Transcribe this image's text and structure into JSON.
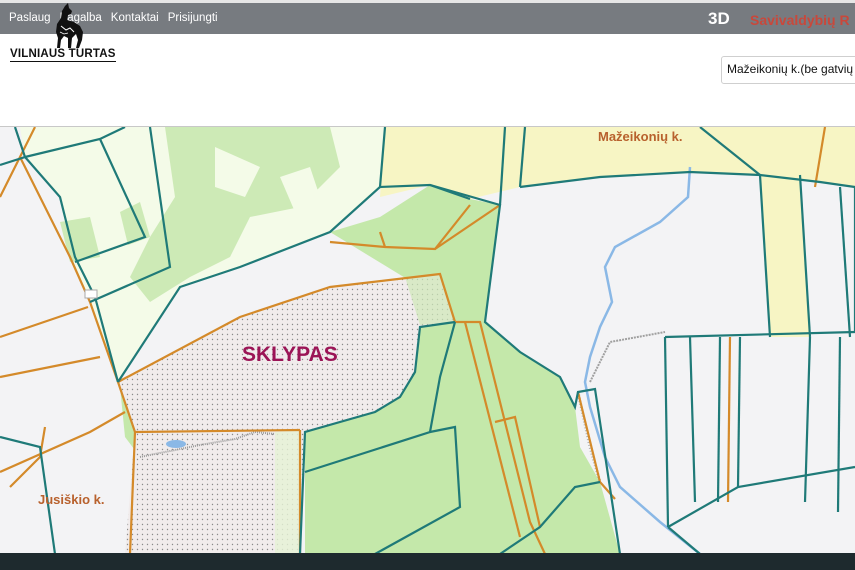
{
  "nav": {
    "items": [
      "Paslaug",
      "Pagalba",
      "Kontaktai",
      "Prisijungti"
    ]
  },
  "header": {
    "btn_3d": "3D",
    "municipality_label": "Savivaldybių R"
  },
  "logo": {
    "text": "VILNIAUS TURTAS",
    "icon": "wolf-icon"
  },
  "locality": {
    "selected": "Mažeikonių k.(be gatvių"
  },
  "map": {
    "labels": {
      "plot": "SKLYPAS",
      "village_north": "Mažeikonių k.",
      "village_west": "Jusiškio k."
    },
    "colors": {
      "forest": "#c2e8a8",
      "light_forest": "#f3fbe6",
      "field": "#f7f5c6",
      "plot_fill": "#efe8e8",
      "teal_boundary": "#1f7a78",
      "orange_boundary": "#d48a2a",
      "water": "#8ab8e6",
      "plot_label": "#9b1456",
      "village_label": "#b8612d"
    }
  }
}
